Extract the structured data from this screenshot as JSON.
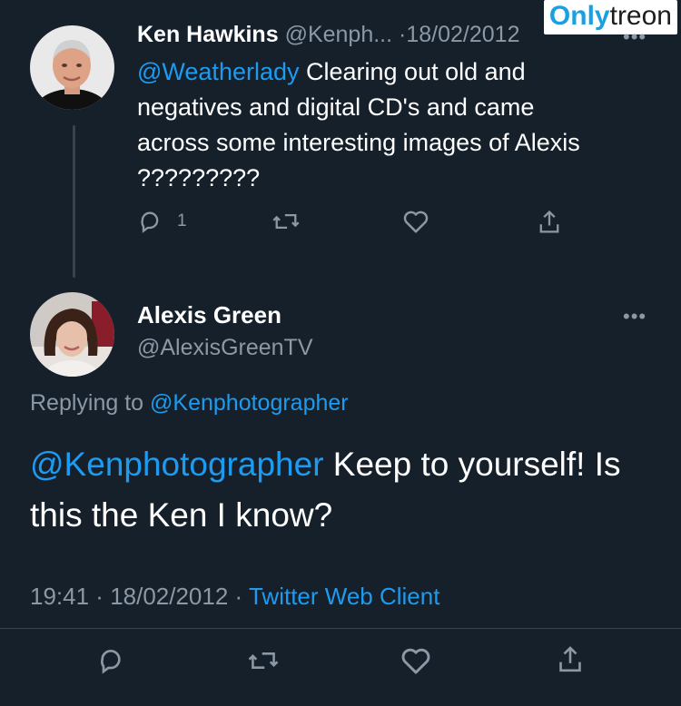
{
  "watermark": {
    "part1": "Only",
    "part2": "treon"
  },
  "parent_tweet": {
    "author_name": "Ken Hawkins",
    "handle": "@Kenph...",
    "separator": "·",
    "date": "18/02/2012",
    "mention": "@Weatherlady",
    "text": " Clearing out old and negatives and digital CD's and came across some interesting images of Alexis ?????????",
    "reply_count": "1",
    "more": "•••"
  },
  "main_tweet": {
    "author_name": "Alexis Green",
    "handle": "@AlexisGreenTV",
    "more": "•••",
    "replying_prefix": "Replying to ",
    "replying_to": "@Kenphotographer",
    "mention": "@Kenphotographer",
    "text": " Keep to yourself! Is this the Ken I know?",
    "time": "19:41",
    "dot1": " · ",
    "date": "18/02/2012",
    "dot2": " · ",
    "client": "Twitter Web Client"
  },
  "icons": [
    "reply-icon",
    "retweet-icon",
    "like-icon",
    "share-icon",
    "more-icon"
  ],
  "colors": {
    "background": "#15202b",
    "accent": "#1d9bf0",
    "muted": "#8b98a5",
    "text": "#ffffff"
  }
}
